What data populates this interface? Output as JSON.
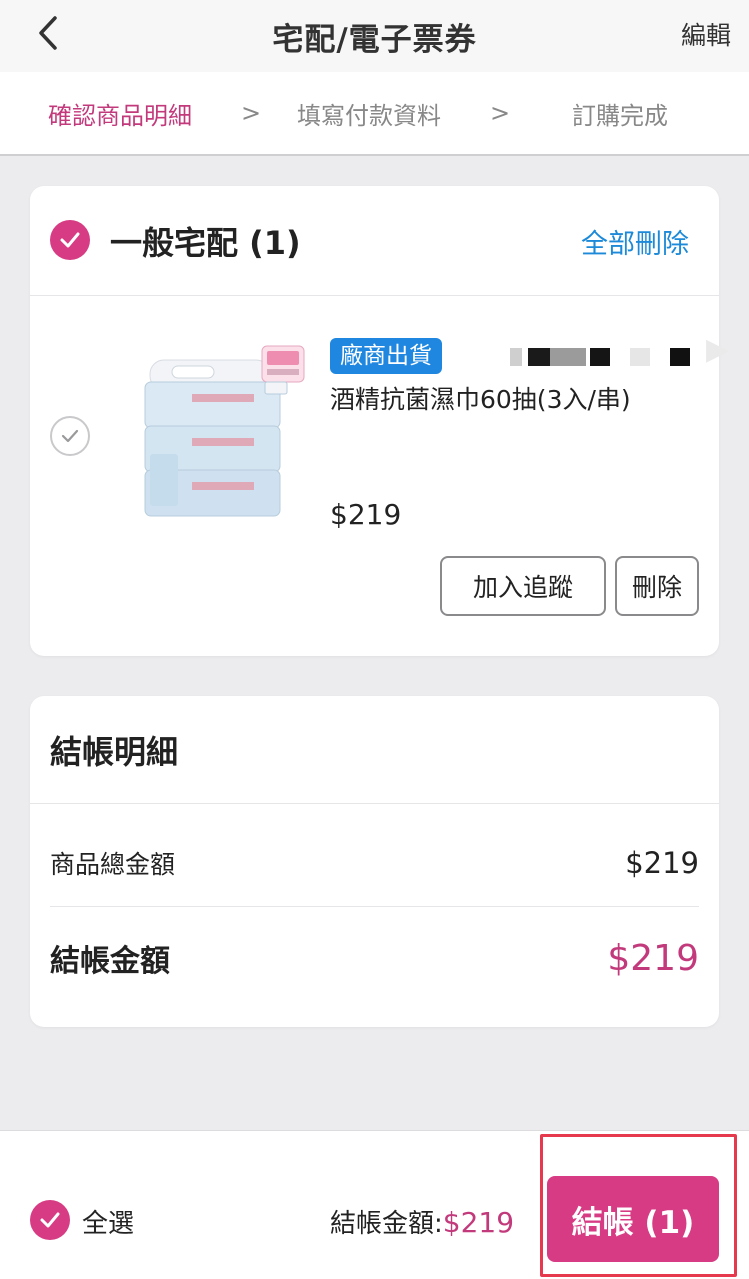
{
  "header": {
    "back_icon": "chevron-left-icon",
    "title": "宅配/電子票券",
    "edit_label": "編輯"
  },
  "steps": {
    "items": [
      "確認商品明細",
      "填寫付款資料",
      "訂購完成"
    ],
    "separator": ">",
    "active_color": "#c33a7c"
  },
  "cart_group": {
    "title": "一般宅配 (1)",
    "delete_all_label": "全部刪除",
    "items": [
      {
        "badge": "廠商出貨",
        "name": "酒精抗菌濕巾60抽(3入/串)",
        "price": "$219",
        "track_label": "加入追蹤",
        "delete_label": "刪除",
        "checked": false
      }
    ]
  },
  "summary": {
    "title": "結帳明細",
    "subtotal_label": "商品總金額",
    "subtotal_value": "$219",
    "total_label": "結帳金額",
    "total_value": "$219"
  },
  "bottom_bar": {
    "select_all_label": "全選",
    "total_label": "結帳金額:",
    "total_value": "$219",
    "checkout_label": "結帳 (1)"
  },
  "colors": {
    "accent": "#d63b84",
    "link": "#1c8ad8",
    "badge": "#1f87e0",
    "highlight": "#e7394d"
  }
}
